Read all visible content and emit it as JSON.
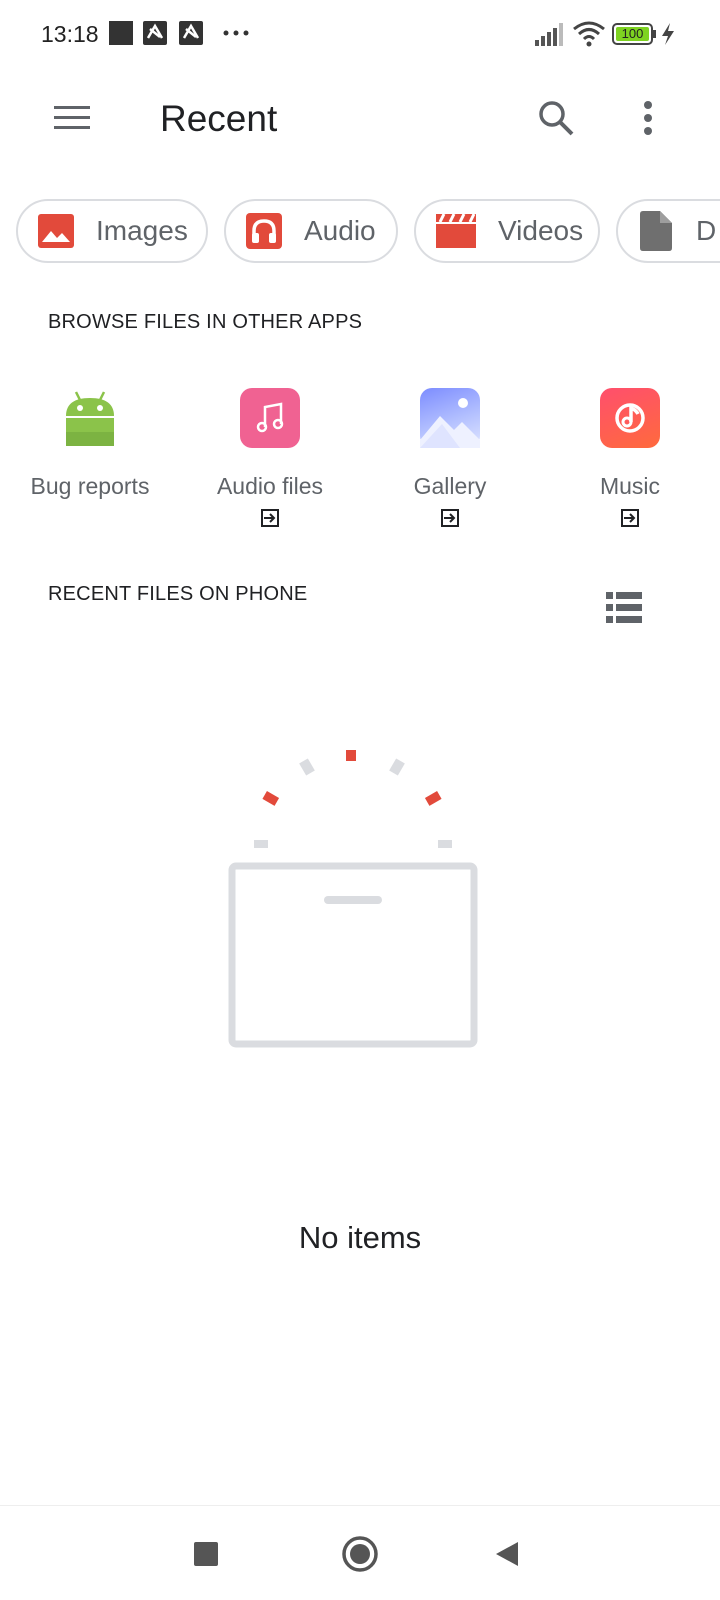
{
  "status_bar": {
    "time": "13:18",
    "battery": "100",
    "icons": [
      "notification-square-icon",
      "notification-app-icon",
      "notification-app-icon",
      "more-notifications-icon",
      "signal-icon",
      "wifi-icon",
      "battery-icon",
      "charging-icon"
    ]
  },
  "app_bar": {
    "title": "Recent",
    "icons": [
      "menu-icon",
      "search-icon",
      "more-vert-icon"
    ]
  },
  "chips": [
    {
      "label": "Images",
      "icon": "image-icon",
      "color": "#e24a3b"
    },
    {
      "label": "Audio",
      "icon": "headphones-icon",
      "color": "#e24a3b"
    },
    {
      "label": "Videos",
      "icon": "clapperboard-icon",
      "color": "#e24a3b"
    },
    {
      "label": "D",
      "icon": "document-icon",
      "color": "#6f6f6f"
    }
  ],
  "browse_section": {
    "header": "BROWSE FILES IN OTHER APPS",
    "apps": [
      {
        "label": "Bug reports",
        "icon": "android-icon",
        "color": "#8bc34a"
      },
      {
        "label": "Audio files",
        "icon": "music-note-icon",
        "color": "#f06292"
      },
      {
        "label": "Gallery",
        "icon": "gallery-icon",
        "color": "#8c9eff"
      },
      {
        "label": "Music",
        "icon": "music-app-icon",
        "color": "#ff4f6d"
      }
    ]
  },
  "recent_section": {
    "header": "RECENT FILES ON PHONE",
    "view_icon": "list-view-icon",
    "empty_text": "No items"
  },
  "nav_bar": {
    "icons": [
      "recents-square-icon",
      "home-circle-icon",
      "back-triangle-icon"
    ]
  },
  "colors": {
    "accent": "#e24a3b",
    "chip_border": "#dadce0",
    "secondary_text": "#5f6368"
  }
}
